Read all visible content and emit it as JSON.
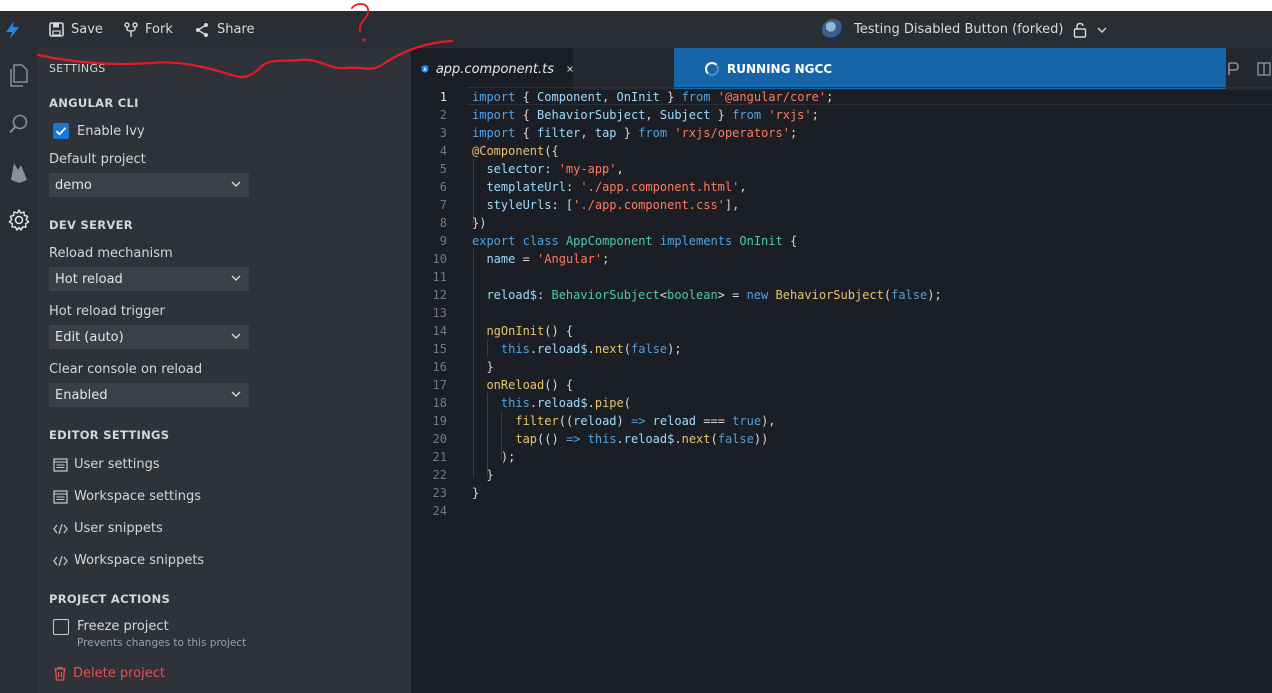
{
  "topbar": {
    "save_label": "Save",
    "fork_label": "Fork",
    "share_label": "Share",
    "project_title": "Testing Disabled Button (forked)"
  },
  "sidebar": {
    "title": "SETTINGS",
    "angular_cli": {
      "heading": "ANGULAR CLI",
      "enable_ivy_label": "Enable Ivy",
      "enable_ivy_checked": true,
      "default_project_label": "Default project",
      "default_project_value": "demo"
    },
    "dev_server": {
      "heading": "DEV SERVER",
      "reload_mechanism_label": "Reload mechanism",
      "reload_mechanism_value": "Hot reload",
      "hot_reload_trigger_label": "Hot reload trigger",
      "hot_reload_trigger_value": "Edit (auto)",
      "clear_console_label": "Clear console on reload",
      "clear_console_value": "Enabled"
    },
    "editor_settings": {
      "heading": "EDITOR SETTINGS",
      "user_settings": "User settings",
      "workspace_settings": "Workspace settings",
      "user_snippets": "User snippets",
      "workspace_snippets": "Workspace snippets"
    },
    "project_actions": {
      "heading": "PROJECT ACTIONS",
      "freeze_label": "Freeze project",
      "freeze_checked": false,
      "freeze_description": "Prevents changes to this project",
      "delete_label": "Delete project"
    }
  },
  "editor": {
    "tab_label": "app.component.ts",
    "banner": "RUNNING NGCC",
    "current_line": 1,
    "line_numbers": [
      "1",
      "2",
      "3",
      "4",
      "5",
      "6",
      "7",
      "8",
      "9",
      "10",
      "11",
      "12",
      "13",
      "14",
      "15",
      "16",
      "17",
      "18",
      "19",
      "20",
      "21",
      "22",
      "23",
      "24"
    ]
  },
  "colors": {
    "accent": "#1976d2",
    "banner": "#1565a8",
    "danger": "#e05252",
    "annotation": "#e31b23"
  },
  "annotation": {
    "mark": "?"
  }
}
